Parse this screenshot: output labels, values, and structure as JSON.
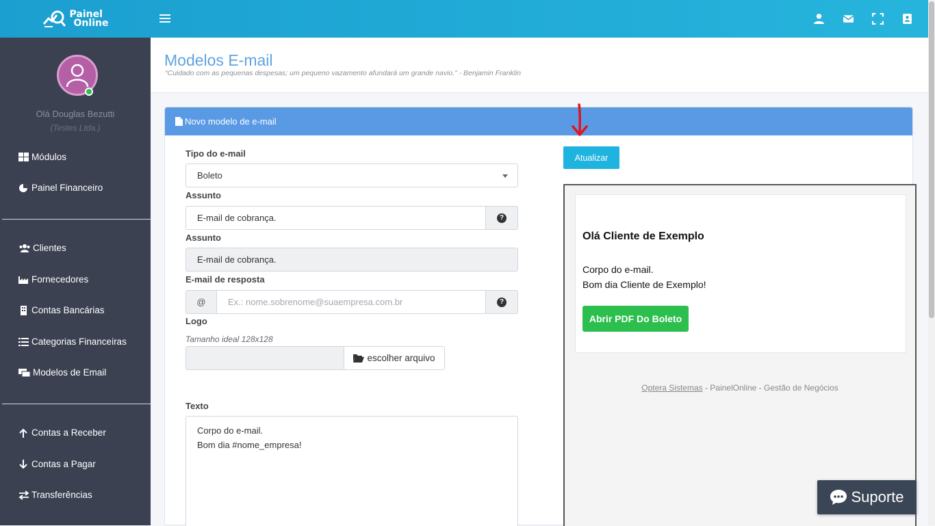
{
  "brand": {
    "line1": "Painel",
    "line2": "Online"
  },
  "topbar": {
    "icons": [
      "user-icon",
      "envelope-icon",
      "fullscreen-icon",
      "contacts-icon"
    ]
  },
  "sidebar": {
    "greeting": "Olá Douglas Bezutti",
    "company": "(Testes Ltda.)",
    "items": [
      {
        "label": "Módulos",
        "icon": "grid-icon"
      },
      {
        "label": "Painel Financeiro",
        "icon": "pie-chart-icon"
      },
      {
        "label": "Clientes",
        "icon": "users-icon"
      },
      {
        "label": "Fornecedores",
        "icon": "industry-icon"
      },
      {
        "label": "Contas Bancárias",
        "icon": "building-icon"
      },
      {
        "label": "Categorias Financeiras",
        "icon": "list-icon"
      },
      {
        "label": "Modelos de Email",
        "icon": "envelopes-icon"
      },
      {
        "label": "Contas a Receber",
        "icon": "arrow-up-icon"
      },
      {
        "label": "Contas a Pagar",
        "icon": "arrow-down-icon"
      },
      {
        "label": "Transferências",
        "icon": "exchange-icon"
      }
    ]
  },
  "page": {
    "title": "Modelos E-mail",
    "quote": "“Cuidado com as pequenas despesas; um pequeno vazamento afundará um grande navio.” - Benjamin Franklin"
  },
  "panel": {
    "title": "Novo modelo de e-mail"
  },
  "form": {
    "tipo_label": "Tipo do e-mail",
    "tipo_value": "Boleto",
    "assunto_label": "Assunto",
    "assunto_value": "E-mail de cobrança.",
    "assunto2_label": "Assunto",
    "assunto2_value": "E-mail de cobrança.",
    "reply_label": "E-mail de resposta",
    "reply_addon": "@",
    "reply_placeholder": "Ex.: nome.sobrenome@suaempresa.com.br",
    "logo_label": "Logo",
    "logo_hint": "Tamanho ideal 128x128",
    "file_button": "escolher arquivo",
    "texto_label": "Texto",
    "texto_lines": [
      "Corpo do e-mail.",
      "Bom dia #nome_empresa!"
    ]
  },
  "actions": {
    "update": "Atualizar"
  },
  "preview": {
    "title": "Olá Cliente de Exemplo",
    "body_lines": [
      "Corpo do e-mail.",
      "Bom dia Cliente de Exemplo!"
    ],
    "button": "Abrir PDF Do Boleto",
    "footer_link": "Optera Sistemas",
    "footer_rest": " - PainelOnline - Gestão de Negócios"
  },
  "support": {
    "label": "Suporte"
  },
  "colors": {
    "topbar": "#1fa0cf",
    "sidebar": "#3c4152",
    "panel_head": "#5a9ae5",
    "update_btn": "#1fb3e0",
    "preview_btn": "#2cbf4e",
    "annotation_arrow": "#e0141e"
  }
}
